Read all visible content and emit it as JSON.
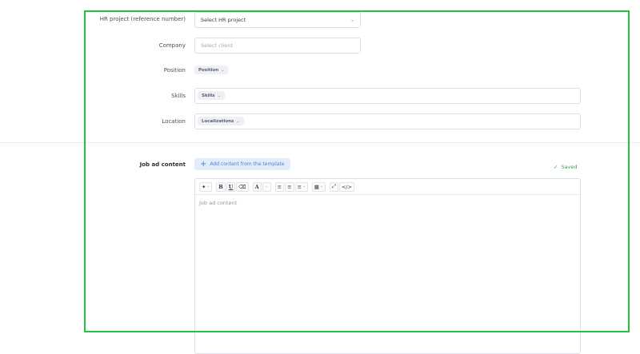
{
  "form": {
    "hr_project": {
      "label": "HR project (reference number)",
      "value": "Select HR project"
    },
    "company": {
      "label": "Company",
      "placeholder": "Select client"
    },
    "position": {
      "label": "Position",
      "chip": "Position"
    },
    "skills": {
      "label": "Skills",
      "chip": "Skills"
    },
    "location": {
      "label": "Location",
      "chip": "Localizations"
    }
  },
  "job_ad": {
    "label": "Job ad content",
    "template_button": "Add content from the template",
    "saved_status": "Saved",
    "editor_placeholder": "Job ad content",
    "toolbar": {
      "bold": "B",
      "underline": "U",
      "font_color": "A",
      "code": "</>"
    }
  },
  "colors": {
    "highlight_border": "#22c43a",
    "saved": "#2fa84f",
    "template_button_bg": "#e2ecfb",
    "template_button_text": "#4d7fd6"
  }
}
